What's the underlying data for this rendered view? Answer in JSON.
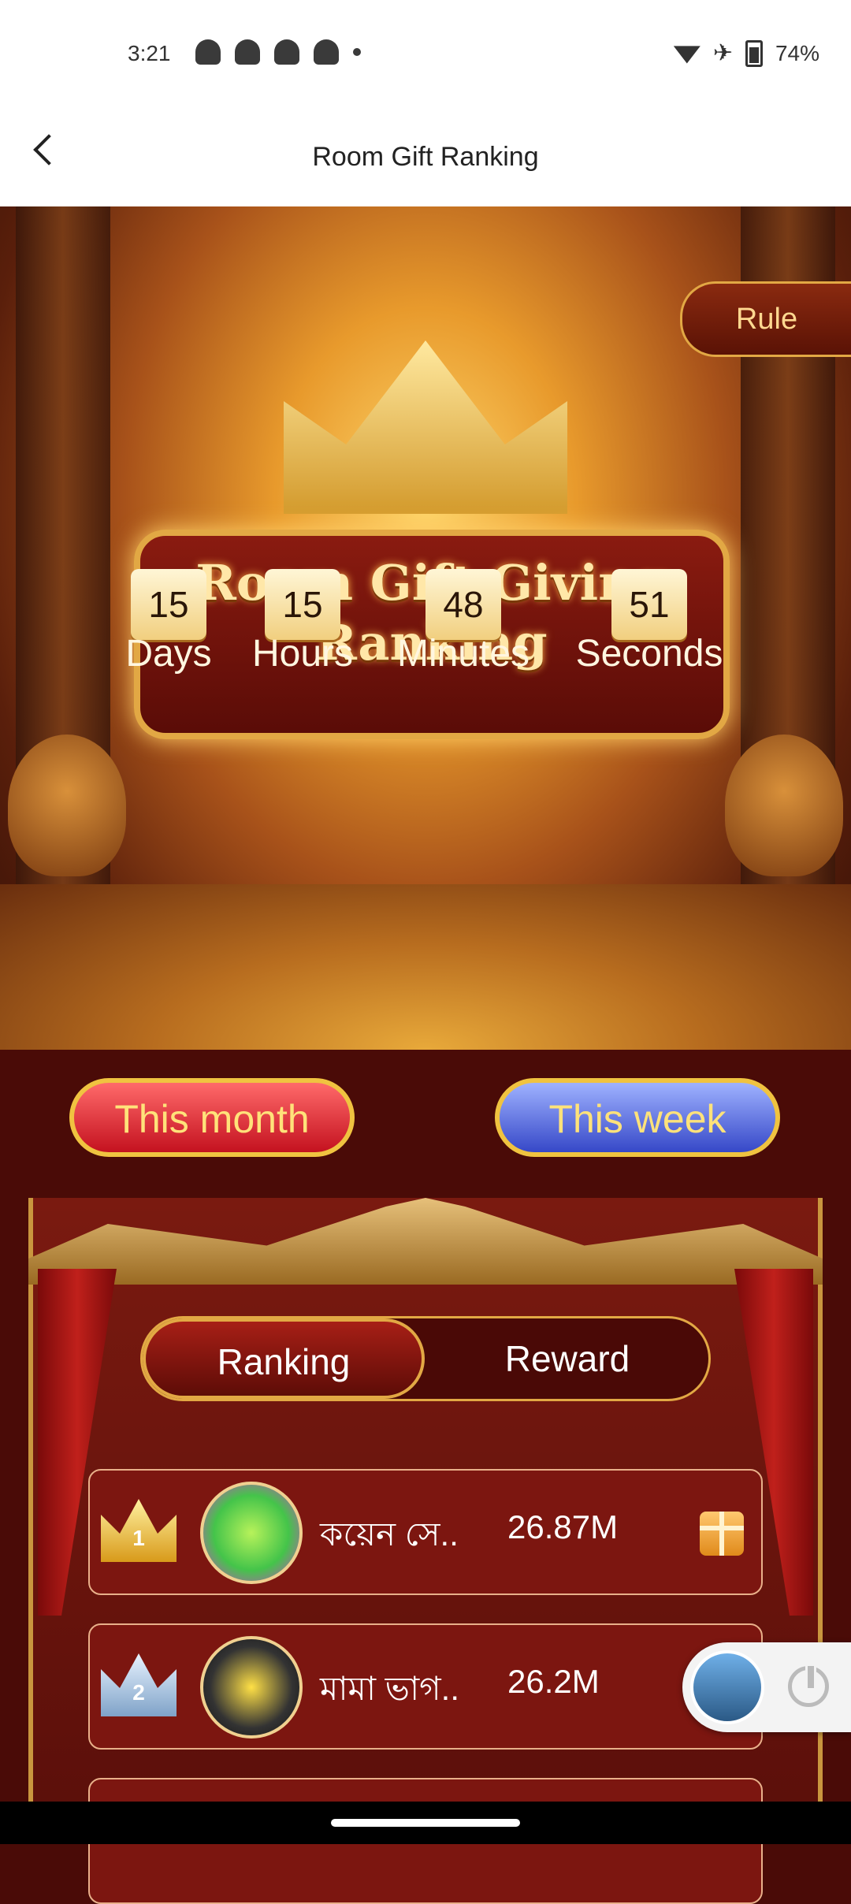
{
  "status_bar": {
    "time": "3:21",
    "battery": "74%"
  },
  "header": {
    "title": "Room Gift Ranking"
  },
  "hero": {
    "title_line1": "Room Gift Giving",
    "title_line2": "Ranking",
    "rule_label": "Rule"
  },
  "countdown": {
    "days": "15",
    "hours": "15",
    "minutes": "48",
    "seconds": "51",
    "days_label": "Days",
    "hours_label": "Hours",
    "minutes_label": "Minutes",
    "seconds_label": "Seconds"
  },
  "period": {
    "month_label": "This month",
    "week_label": "This week"
  },
  "tabs": {
    "ranking": "Ranking",
    "reward": "Reward"
  },
  "ranking": [
    {
      "rank": "1",
      "name": "কয়েন সে..",
      "score": "26.87M",
      "icon": "gift-icon"
    },
    {
      "rank": "2",
      "name": "মামা ভাগ..",
      "score": "26.2M"
    }
  ],
  "colors": {
    "accent_gold": "#e2a844",
    "board_bg": "#7a1a10"
  }
}
